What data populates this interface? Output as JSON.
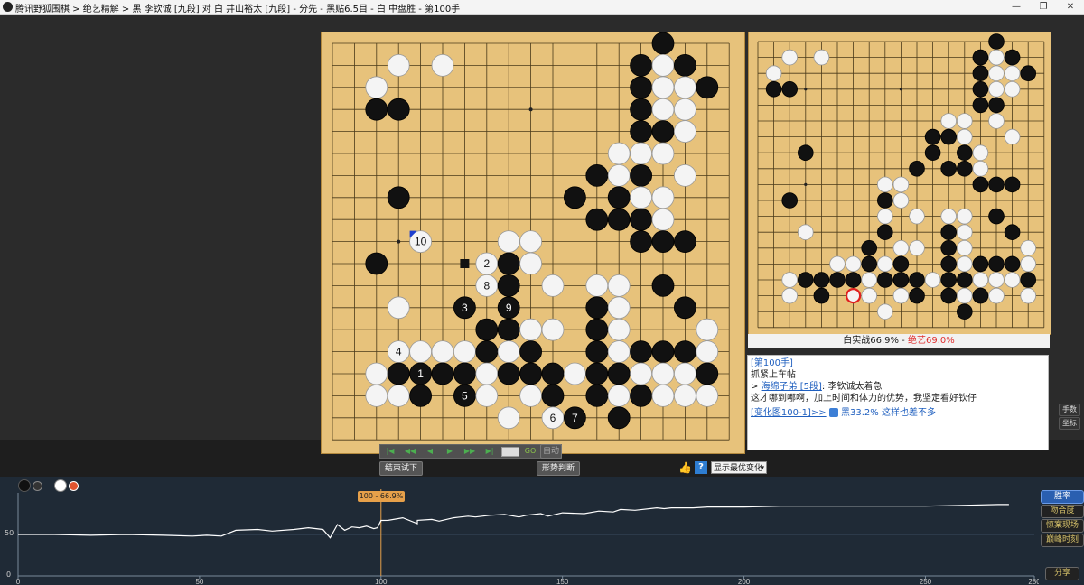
{
  "window": {
    "title": "腾讯野狐围棋 > 绝艺精解 > 黑 李钦诚 [九段] 对 白 井山裕太 [九段] - 分先 - 黑贴6.5目 - 白 中盘胜 - 第100手",
    "controls": [
      "—",
      "❐",
      "✕"
    ]
  },
  "main_board": {
    "stones": [
      {
        "c": "W",
        "x": 3,
        "y": 1
      },
      {
        "c": "W",
        "x": 5,
        "y": 1
      },
      {
        "c": "B",
        "x": 15,
        "y": 0
      },
      {
        "c": "B",
        "x": 14,
        "y": 1
      },
      {
        "c": "W",
        "x": 15,
        "y": 1
      },
      {
        "c": "B",
        "x": 16,
        "y": 1
      },
      {
        "c": "B",
        "x": 17,
        "y": 2
      },
      {
        "c": "W",
        "x": 2,
        "y": 2
      },
      {
        "c": "B",
        "x": 2,
        "y": 3
      },
      {
        "c": "B",
        "x": 3,
        "y": 3
      },
      {
        "c": "B",
        "x": 14,
        "y": 2
      },
      {
        "c": "W",
        "x": 15,
        "y": 2
      },
      {
        "c": "W",
        "x": 16,
        "y": 2
      },
      {
        "c": "B",
        "x": 14,
        "y": 3
      },
      {
        "c": "W",
        "x": 15,
        "y": 3
      },
      {
        "c": "W",
        "x": 16,
        "y": 3
      },
      {
        "c": "B",
        "x": 14,
        "y": 4
      },
      {
        "c": "B",
        "x": 15,
        "y": 4
      },
      {
        "c": "W",
        "x": 16,
        "y": 4
      },
      {
        "c": "W",
        "x": 13,
        "y": 5
      },
      {
        "c": "W",
        "x": 14,
        "y": 5
      },
      {
        "c": "W",
        "x": 15,
        "y": 5
      },
      {
        "c": "B",
        "x": 12,
        "y": 6
      },
      {
        "c": "W",
        "x": 13,
        "y": 6
      },
      {
        "c": "B",
        "x": 14,
        "y": 6
      },
      {
        "c": "W",
        "x": 16,
        "y": 6
      },
      {
        "c": "B",
        "x": 3,
        "y": 7
      },
      {
        "c": "B",
        "x": 11,
        "y": 7
      },
      {
        "c": "B",
        "x": 13,
        "y": 7
      },
      {
        "c": "W",
        "x": 14,
        "y": 7
      },
      {
        "c": "W",
        "x": 15,
        "y": 7
      },
      {
        "c": "B",
        "x": 12,
        "y": 8
      },
      {
        "c": "B",
        "x": 13,
        "y": 8
      },
      {
        "c": "B",
        "x": 14,
        "y": 8
      },
      {
        "c": "W",
        "x": 15,
        "y": 8
      },
      {
        "c": "B",
        "x": 14,
        "y": 9
      },
      {
        "c": "B",
        "x": 15,
        "y": 9
      },
      {
        "c": "B",
        "x": 16,
        "y": 9
      },
      {
        "c": "W",
        "x": 8,
        "y": 9
      },
      {
        "c": "W",
        "x": 9,
        "y": 9
      },
      {
        "c": "B",
        "x": 2,
        "y": 10
      },
      {
        "c": "W",
        "x": 7,
        "y": 10,
        "n": "2"
      },
      {
        "c": "B",
        "x": 8,
        "y": 10
      },
      {
        "c": "W",
        "x": 9,
        "y": 10
      },
      {
        "c": "W",
        "x": 7,
        "y": 11,
        "n": "8"
      },
      {
        "c": "B",
        "x": 8,
        "y": 11
      },
      {
        "c": "W",
        "x": 10,
        "y": 11
      },
      {
        "c": "W",
        "x": 12,
        "y": 11
      },
      {
        "c": "W",
        "x": 13,
        "y": 11
      },
      {
        "c": "B",
        "x": 15,
        "y": 11
      },
      {
        "c": "W",
        "x": 3,
        "y": 12
      },
      {
        "c": "B",
        "x": 6,
        "y": 12,
        "n": "3"
      },
      {
        "c": "B",
        "x": 8,
        "y": 12,
        "n": "9"
      },
      {
        "c": "B",
        "x": 12,
        "y": 12
      },
      {
        "c": "W",
        "x": 13,
        "y": 12
      },
      {
        "c": "B",
        "x": 16,
        "y": 12
      },
      {
        "c": "B",
        "x": 7,
        "y": 13
      },
      {
        "c": "B",
        "x": 8,
        "y": 13
      },
      {
        "c": "W",
        "x": 9,
        "y": 13
      },
      {
        "c": "W",
        "x": 10,
        "y": 13
      },
      {
        "c": "B",
        "x": 12,
        "y": 13
      },
      {
        "c": "W",
        "x": 13,
        "y": 13
      },
      {
        "c": "W",
        "x": 17,
        "y": 13
      },
      {
        "c": "W",
        "x": 3,
        "y": 14,
        "n": "4"
      },
      {
        "c": "W",
        "x": 4,
        "y": 14
      },
      {
        "c": "W",
        "x": 5,
        "y": 14
      },
      {
        "c": "W",
        "x": 6,
        "y": 14
      },
      {
        "c": "B",
        "x": 7,
        "y": 14
      },
      {
        "c": "W",
        "x": 8,
        "y": 14
      },
      {
        "c": "B",
        "x": 9,
        "y": 14
      },
      {
        "c": "B",
        "x": 12,
        "y": 14
      },
      {
        "c": "W",
        "x": 13,
        "y": 14
      },
      {
        "c": "B",
        "x": 14,
        "y": 14
      },
      {
        "c": "B",
        "x": 15,
        "y": 14
      },
      {
        "c": "B",
        "x": 16,
        "y": 14
      },
      {
        "c": "W",
        "x": 17,
        "y": 14
      },
      {
        "c": "W",
        "x": 2,
        "y": 15
      },
      {
        "c": "B",
        "x": 3,
        "y": 15
      },
      {
        "c": "B",
        "x": 4,
        "y": 15,
        "n": "1"
      },
      {
        "c": "B",
        "x": 5,
        "y": 15
      },
      {
        "c": "B",
        "x": 6,
        "y": 15
      },
      {
        "c": "W",
        "x": 7,
        "y": 15
      },
      {
        "c": "B",
        "x": 8,
        "y": 15
      },
      {
        "c": "B",
        "x": 9,
        "y": 15
      },
      {
        "c": "B",
        "x": 10,
        "y": 15
      },
      {
        "c": "W",
        "x": 11,
        "y": 15
      },
      {
        "c": "B",
        "x": 12,
        "y": 15
      },
      {
        "c": "B",
        "x": 13,
        "y": 15
      },
      {
        "c": "W",
        "x": 14,
        "y": 15
      },
      {
        "c": "W",
        "x": 15,
        "y": 15
      },
      {
        "c": "W",
        "x": 16,
        "y": 15
      },
      {
        "c": "B",
        "x": 17,
        "y": 15
      },
      {
        "c": "W",
        "x": 2,
        "y": 16
      },
      {
        "c": "W",
        "x": 3,
        "y": 16
      },
      {
        "c": "B",
        "x": 4,
        "y": 16
      },
      {
        "c": "B",
        "x": 6,
        "y": 16,
        "n": "5"
      },
      {
        "c": "W",
        "x": 7,
        "y": 16
      },
      {
        "c": "W",
        "x": 9,
        "y": 16
      },
      {
        "c": "B",
        "x": 10,
        "y": 16
      },
      {
        "c": "B",
        "x": 12,
        "y": 16
      },
      {
        "c": "W",
        "x": 13,
        "y": 16
      },
      {
        "c": "B",
        "x": 14,
        "y": 16
      },
      {
        "c": "W",
        "x": 15,
        "y": 16
      },
      {
        "c": "W",
        "x": 16,
        "y": 16
      },
      {
        "c": "W",
        "x": 17,
        "y": 16
      },
      {
        "c": "W",
        "x": 8,
        "y": 17
      },
      {
        "c": "W",
        "x": 10,
        "y": 17,
        "n": "6"
      },
      {
        "c": "B",
        "x": 11,
        "y": 17,
        "n": "7"
      },
      {
        "c": "B",
        "x": 13,
        "y": 17
      },
      {
        "c": "W",
        "x": 4,
        "y": 9,
        "n": "10"
      }
    ],
    "square_marker": {
      "x": 6,
      "y": 10
    },
    "triangle_marker": {
      "x": 4,
      "y": 9
    }
  },
  "mini_board": {
    "stones": [
      {
        "c": "W",
        "x": 2,
        "y": 1
      },
      {
        "c": "W",
        "x": 4,
        "y": 1
      },
      {
        "c": "B",
        "x": 15,
        "y": 0
      },
      {
        "c": "B",
        "x": 14,
        "y": 1
      },
      {
        "c": "W",
        "x": 15,
        "y": 1
      },
      {
        "c": "B",
        "x": 16,
        "y": 1
      },
      {
        "c": "B",
        "x": 17,
        "y": 2
      },
      {
        "c": "W",
        "x": 1,
        "y": 2
      },
      {
        "c": "B",
        "x": 1,
        "y": 3
      },
      {
        "c": "B",
        "x": 2,
        "y": 3
      },
      {
        "c": "B",
        "x": 14,
        "y": 2
      },
      {
        "c": "W",
        "x": 15,
        "y": 2
      },
      {
        "c": "W",
        "x": 16,
        "y": 2
      },
      {
        "c": "B",
        "x": 14,
        "y": 3
      },
      {
        "c": "W",
        "x": 15,
        "y": 3
      },
      {
        "c": "W",
        "x": 16,
        "y": 3
      },
      {
        "c": "B",
        "x": 14,
        "y": 4
      },
      {
        "c": "B",
        "x": 15,
        "y": 4
      },
      {
        "c": "W",
        "x": 15,
        "y": 5
      },
      {
        "c": "W",
        "x": 13,
        "y": 5
      },
      {
        "c": "W",
        "x": 12,
        "y": 5
      },
      {
        "c": "W",
        "x": 16,
        "y": 6
      },
      {
        "c": "B",
        "x": 12,
        "y": 6
      },
      {
        "c": "W",
        "x": 13,
        "y": 6
      },
      {
        "c": "B",
        "x": 11,
        "y": 6
      },
      {
        "c": "B",
        "x": 3,
        "y": 7
      },
      {
        "c": "B",
        "x": 11,
        "y": 7
      },
      {
        "c": "B",
        "x": 13,
        "y": 7
      },
      {
        "c": "W",
        "x": 14,
        "y": 7
      },
      {
        "c": "B",
        "x": 10,
        "y": 8
      },
      {
        "c": "B",
        "x": 12,
        "y": 8
      },
      {
        "c": "B",
        "x": 13,
        "y": 8
      },
      {
        "c": "W",
        "x": 14,
        "y": 8
      },
      {
        "c": "B",
        "x": 14,
        "y": 9
      },
      {
        "c": "B",
        "x": 15,
        "y": 9
      },
      {
        "c": "B",
        "x": 16,
        "y": 9
      },
      {
        "c": "W",
        "x": 8,
        "y": 9
      },
      {
        "c": "W",
        "x": 9,
        "y": 9
      },
      {
        "c": "B",
        "x": 2,
        "y": 10
      },
      {
        "c": "B",
        "x": 8,
        "y": 10
      },
      {
        "c": "W",
        "x": 9,
        "y": 10
      },
      {
        "c": "W",
        "x": 8,
        "y": 11
      },
      {
        "c": "W",
        "x": 10,
        "y": 11
      },
      {
        "c": "W",
        "x": 12,
        "y": 11
      },
      {
        "c": "W",
        "x": 13,
        "y": 11
      },
      {
        "c": "B",
        "x": 15,
        "y": 11
      },
      {
        "c": "W",
        "x": 3,
        "y": 12
      },
      {
        "c": "B",
        "x": 8,
        "y": 12
      },
      {
        "c": "B",
        "x": 12,
        "y": 12
      },
      {
        "c": "W",
        "x": 13,
        "y": 12
      },
      {
        "c": "B",
        "x": 16,
        "y": 12
      },
      {
        "c": "B",
        "x": 7,
        "y": 13
      },
      {
        "c": "W",
        "x": 9,
        "y": 13
      },
      {
        "c": "W",
        "x": 10,
        "y": 13
      },
      {
        "c": "B",
        "x": 12,
        "y": 13
      },
      {
        "c": "W",
        "x": 13,
        "y": 13
      },
      {
        "c": "W",
        "x": 17,
        "y": 13
      },
      {
        "c": "W",
        "x": 5,
        "y": 14
      },
      {
        "c": "W",
        "x": 6,
        "y": 14
      },
      {
        "c": "B",
        "x": 7,
        "y": 14
      },
      {
        "c": "W",
        "x": 8,
        "y": 14
      },
      {
        "c": "B",
        "x": 9,
        "y": 14
      },
      {
        "c": "B",
        "x": 12,
        "y": 14
      },
      {
        "c": "W",
        "x": 13,
        "y": 14
      },
      {
        "c": "B",
        "x": 14,
        "y": 14
      },
      {
        "c": "B",
        "x": 15,
        "y": 14
      },
      {
        "c": "B",
        "x": 16,
        "y": 14
      },
      {
        "c": "W",
        "x": 17,
        "y": 14
      },
      {
        "c": "W",
        "x": 2,
        "y": 15
      },
      {
        "c": "B",
        "x": 3,
        "y": 15
      },
      {
        "c": "B",
        "x": 4,
        "y": 15
      },
      {
        "c": "B",
        "x": 5,
        "y": 15
      },
      {
        "c": "B",
        "x": 6,
        "y": 15
      },
      {
        "c": "W",
        "x": 7,
        "y": 15
      },
      {
        "c": "B",
        "x": 8,
        "y": 15
      },
      {
        "c": "B",
        "x": 9,
        "y": 15
      },
      {
        "c": "B",
        "x": 10,
        "y": 15
      },
      {
        "c": "W",
        "x": 11,
        "y": 15
      },
      {
        "c": "B",
        "x": 12,
        "y": 15
      },
      {
        "c": "B",
        "x": 13,
        "y": 15
      },
      {
        "c": "W",
        "x": 14,
        "y": 15
      },
      {
        "c": "W",
        "x": 15,
        "y": 15
      },
      {
        "c": "W",
        "x": 16,
        "y": 15
      },
      {
        "c": "B",
        "x": 17,
        "y": 15
      },
      {
        "c": "W",
        "x": 2,
        "y": 16
      },
      {
        "c": "B",
        "x": 4,
        "y": 16
      },
      {
        "c": "W",
        "x": 7,
        "y": 16
      },
      {
        "c": "W",
        "x": 9,
        "y": 16
      },
      {
        "c": "B",
        "x": 10,
        "y": 16
      },
      {
        "c": "B",
        "x": 12,
        "y": 16
      },
      {
        "c": "W",
        "x": 13,
        "y": 16
      },
      {
        "c": "B",
        "x": 14,
        "y": 16
      },
      {
        "c": "W",
        "x": 15,
        "y": 16
      },
      {
        "c": "W",
        "x": 17,
        "y": 16
      },
      {
        "c": "W",
        "x": 8,
        "y": 17
      },
      {
        "c": "B",
        "x": 13,
        "y": 17
      }
    ],
    "red_ring": {
      "x": 6,
      "y": 16
    },
    "score_left": "白实战66.9% - ",
    "score_right": "绝艺69.0%"
  },
  "comment": {
    "move_label": "[第100手]",
    "line1": "抓紧上车帖",
    "user_prefix": "> ",
    "user_name": "海绵子弟 [5段]",
    "user_text": ": 李钦诚太着急",
    "line3": "这才哪到哪啊，加上时间和体力的优势，我坚定看好钦仔",
    "variation_link": "[变化图100-1]>>",
    "variation_pct": "黑33.2%",
    "variation_text": "这样也差不多"
  },
  "side_buttons": {
    "manual": "手数",
    "coord": "坐标"
  },
  "controls": {
    "nav_icons": [
      "|◀",
      "◀◀",
      "◀",
      "▶",
      "▶▶",
      "▶|"
    ],
    "go_label": "GO",
    "auto_label": "自动",
    "end_trial": "结束试下",
    "judge": "形势判断",
    "help_icon": "?",
    "variation_select": "显示最优变化"
  },
  "graph_panel": {
    "tooltip": "100 - 66.9%",
    "ytick_50": "50",
    "ytick_0": "0",
    "xticks": [
      "0",
      "50",
      "100",
      "150",
      "200",
      "250",
      "280"
    ],
    "buttons": [
      "胜率",
      "吻合度",
      "惊案现场",
      "巅峰时刻"
    ],
    "share": "分享"
  },
  "chart_data": {
    "type": "line",
    "title": "",
    "xlabel": "",
    "ylabel": "",
    "xlim": [
      0,
      280
    ],
    "ylim": [
      0,
      100
    ],
    "series": [
      {
        "x": [
          0,
          10,
          20,
          30,
          40,
          48,
          52,
          56,
          60,
          66,
          70,
          76,
          80,
          84,
          86,
          88,
          90,
          92,
          94,
          96,
          98,
          99,
          100,
          102,
          106,
          110,
          110,
          114,
          116,
          120,
          124,
          126,
          130,
          134,
          138,
          140,
          144,
          146,
          148,
          150,
          156,
          160,
          164,
          166,
          170,
          176,
          178,
          180,
          186,
          190,
          200,
          210,
          220,
          230,
          240,
          250,
          260,
          270,
          273
        ],
        "values": [
          50,
          50,
          49,
          50,
          49,
          48,
          49,
          48,
          55,
          56,
          54,
          56,
          58,
          56,
          46,
          62,
          55,
          59,
          58,
          60,
          57,
          58,
          66.9,
          67,
          70,
          63,
          67,
          68,
          66,
          70,
          72,
          71,
          73,
          74,
          71,
          73,
          75,
          72,
          74,
          76,
          75,
          78,
          77,
          80,
          79,
          82,
          81,
          82,
          82,
          83,
          83,
          84,
          84,
          84,
          84,
          84,
          85,
          86,
          86
        ]
      }
    ]
  },
  "colors": {
    "accent": "#2a5fb0",
    "move_marker": "#e6a04a",
    "stone_black": "#111111",
    "stone_white": "#f4f4f4"
  }
}
